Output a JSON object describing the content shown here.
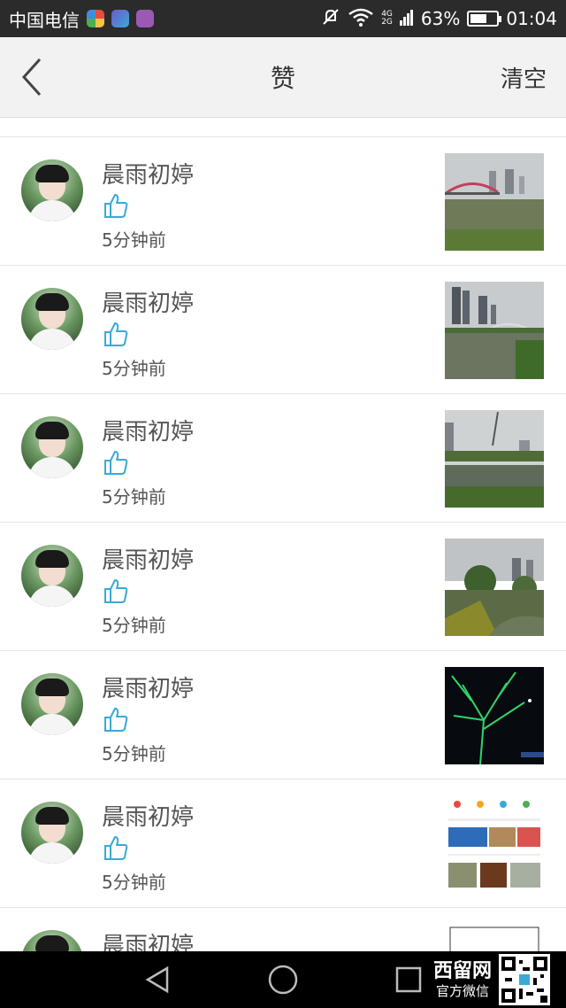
{
  "status_bar": {
    "carrier": "中国电信",
    "net_top": "4G",
    "net_bottom": "2G",
    "battery": "63%",
    "battery_level": 0.63,
    "time": "01:04"
  },
  "header": {
    "title": "赞",
    "clear_label": "清空"
  },
  "likes": [
    {
      "name": "晨雨初婷",
      "time": "5分钟前",
      "thumb": "bridge-river"
    },
    {
      "name": "晨雨初婷",
      "time": "5分钟前",
      "thumb": "river-towers"
    },
    {
      "name": "晨雨初婷",
      "time": "5分钟前",
      "thumb": "river-bank"
    },
    {
      "name": "晨雨初婷",
      "time": "5分钟前",
      "thumb": "park-trees"
    },
    {
      "name": "晨雨初婷",
      "time": "5分钟前",
      "thumb": "night-tree-lights"
    },
    {
      "name": "晨雨初婷",
      "time": "5分钟前",
      "thumb": "app-screenshot"
    },
    {
      "name": "晨雨初婷",
      "time": "",
      "thumb": "sketch"
    }
  ],
  "watermark": {
    "brand": "西留网",
    "subtitle": "官方微信"
  },
  "colors": {
    "like_icon": "#3aa9d8",
    "status_bar": "#2b2b2b",
    "header_bg": "#f2f2f2"
  }
}
